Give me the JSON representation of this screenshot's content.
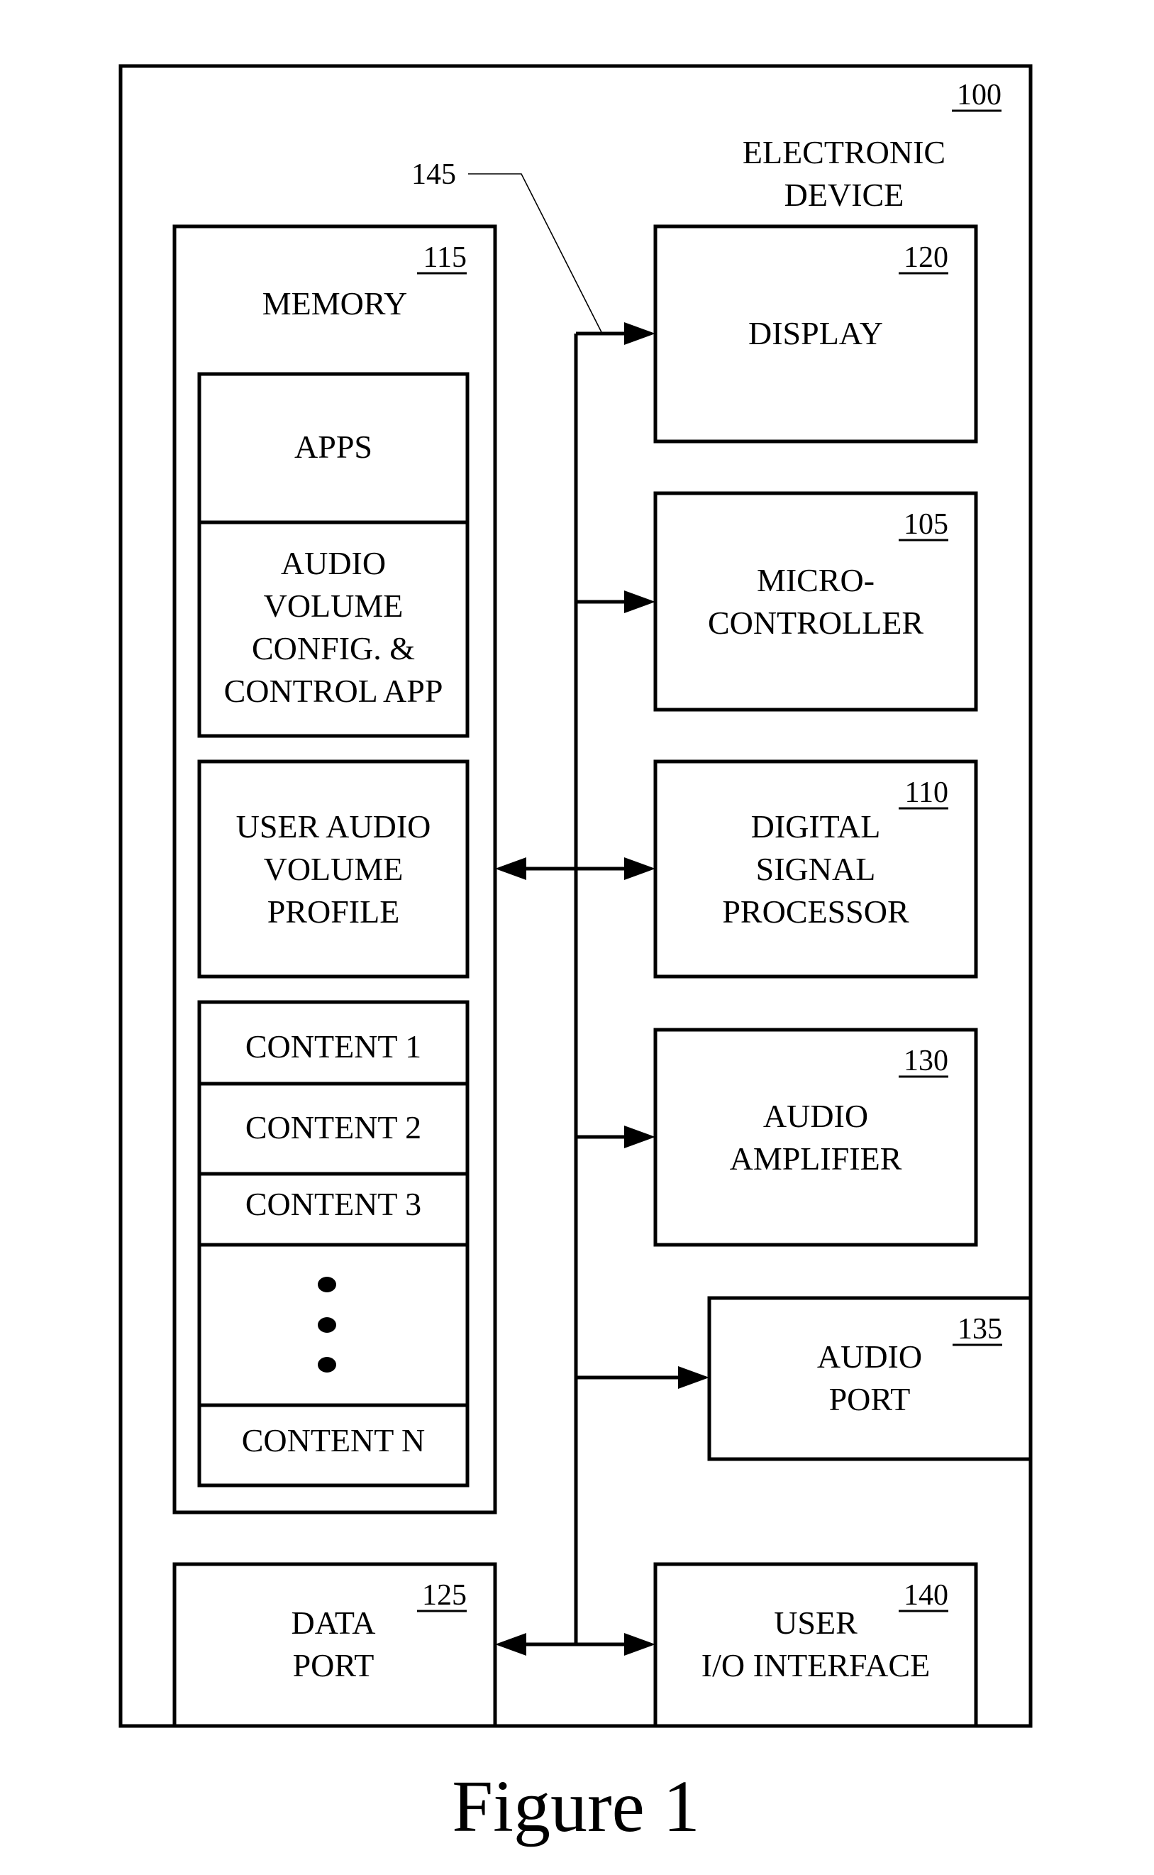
{
  "figure": {
    "caption": "Figure 1",
    "bus_ref": "145"
  },
  "device": {
    "ref": "100",
    "title_lines": [
      "ELECTRONIC",
      "DEVICE"
    ]
  },
  "memory": {
    "ref": "115",
    "title": "MEMORY",
    "apps_label": "APPS",
    "app_control_lines": [
      "AUDIO",
      "VOLUME",
      "CONFIG. &",
      "CONTROL APP"
    ],
    "profile_lines": [
      "USER AUDIO",
      "VOLUME",
      "PROFILE"
    ],
    "contents": [
      "CONTENT 1",
      "CONTENT 2",
      "CONTENT 3",
      "CONTENT N"
    ],
    "ellipsis_icon": "vertical-ellipsis"
  },
  "components": {
    "display": {
      "ref": "120",
      "lines": [
        "DISPLAY"
      ]
    },
    "microcontroller": {
      "ref": "105",
      "lines": [
        "MICRO-",
        "CONTROLLER"
      ]
    },
    "dsp": {
      "ref": "110",
      "lines": [
        "DIGITAL",
        "SIGNAL",
        "PROCESSOR"
      ]
    },
    "amplifier": {
      "ref": "130",
      "lines": [
        "AUDIO",
        "AMPLIFIER"
      ]
    },
    "audio_port": {
      "ref": "135",
      "lines": [
        "AUDIO",
        "PORT"
      ]
    },
    "data_port": {
      "ref": "125",
      "lines": [
        "DATA",
        "PORT"
      ]
    },
    "user_io": {
      "ref": "140",
      "lines": [
        "USER",
        "I/O INTERFACE"
      ]
    }
  }
}
